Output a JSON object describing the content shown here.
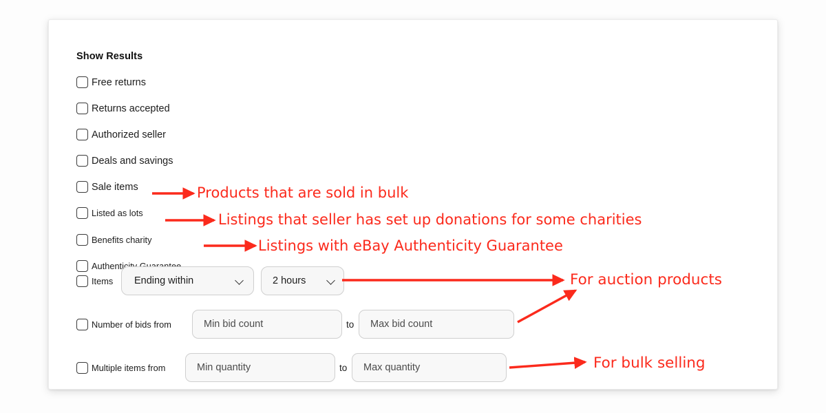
{
  "panel": {
    "title": "Show Results",
    "checkboxes": [
      {
        "label": "Free returns",
        "size": "lg"
      },
      {
        "label": "Returns accepted",
        "size": "lg"
      },
      {
        "label": "Authorized seller",
        "size": "lg"
      },
      {
        "label": "Deals and savings",
        "size": "lg"
      },
      {
        "label": "Sale items",
        "size": "lg"
      },
      {
        "label": "Listed as lots",
        "size": "sm"
      },
      {
        "label": "Benefits charity",
        "size": "sm"
      },
      {
        "label": "Authenticity Guarantee",
        "size": "sm"
      }
    ],
    "items_row": {
      "checkbox_label": "Items",
      "select_condition": "Ending within",
      "select_duration": "2 hours"
    },
    "bids_row": {
      "checkbox_label": "Number of bids from",
      "min_placeholder": "Min bid count",
      "separator": "to",
      "max_placeholder": "Max bid count"
    },
    "quantity_row": {
      "checkbox_label": "Multiple items from",
      "min_placeholder": "Min quantity",
      "separator": "to",
      "max_placeholder": "Max quantity"
    }
  },
  "annotations": [
    {
      "text": "Products that are sold in bulk"
    },
    {
      "text": "Listings that seller has set up donations for some charities"
    },
    {
      "text": "Listings with eBay Authenticity Guarantee"
    },
    {
      "text": "For auction products"
    },
    {
      "text": "For bulk selling"
    }
  ],
  "colors": {
    "annotation_red": "#fb2a1c",
    "text": "#1c1c1c",
    "field_bg": "#f7f7f7",
    "field_border": "#cfcfcf"
  }
}
